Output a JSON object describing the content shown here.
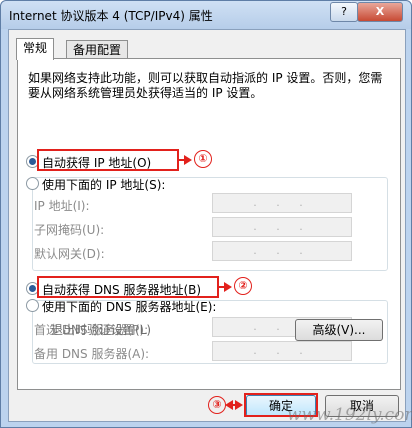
{
  "window": {
    "title": "Internet 协议版本 4 (TCP/IPv4) 属性",
    "help_label": "?",
    "close_label": "X"
  },
  "tabs": [
    {
      "label": "常规"
    },
    {
      "label": "备用配置"
    }
  ],
  "description": "如果网络支持此功能，则可以获取自动指派的 IP 设置。否则，您需要从网络系统管理员处获得适当的 IP 设置。",
  "ip": {
    "auto_label": "自动获得 IP 地址(O)",
    "manual_label": "使用下面的 IP 地址(S):",
    "fields": [
      {
        "label": "IP 地址(I):"
      },
      {
        "label": "子网掩码(U):"
      },
      {
        "label": "默认网关(D):"
      }
    ]
  },
  "dns": {
    "auto_label": "自动获得 DNS 服务器地址(B)",
    "manual_label": "使用下面的 DNS 服务器地址(E):",
    "fields": [
      {
        "label": "首选 DNS 服务器(P):"
      },
      {
        "label": "备用 DNS 服务器(A):"
      }
    ]
  },
  "ip_placeholder": ". . .",
  "validate_label": "退出时验证设置(L)",
  "advanced_label": "高级(V)...",
  "ok_label": "确定",
  "cancel_label": "取消",
  "annotations": {
    "one": "①",
    "two": "②",
    "three": "③"
  },
  "watermark": "www.192ly.com",
  "colors": {
    "annotation": "#e2211c",
    "title_gradient_top": "#cfe0f4",
    "dialog_bg": "#f0f0f0"
  }
}
